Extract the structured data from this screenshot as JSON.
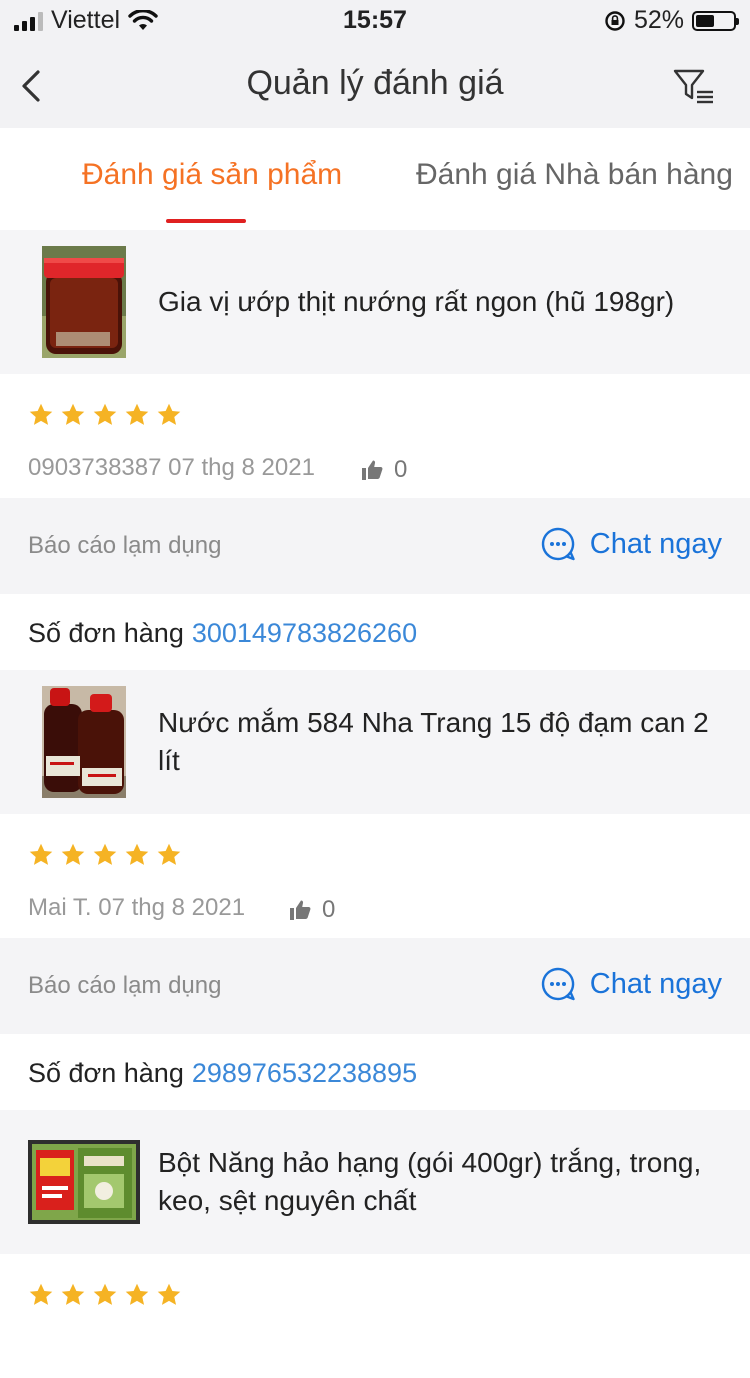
{
  "status_bar": {
    "carrier": "Viettel",
    "time": "15:57",
    "battery": "52%"
  },
  "nav": {
    "title": "Quản lý đánh giá",
    "back_icon": "back-chevron-icon",
    "filter_icon": "filter-icon"
  },
  "tabs": [
    {
      "label": "Đánh giá sản phẩm",
      "active": true
    },
    {
      "label": "Đánh giá Nhà bán hàng",
      "active": false
    }
  ],
  "reviews": [
    {
      "product_name": "Gia vị ướp thịt nướng rất ngon (hũ 198gr)",
      "stars": 5,
      "meta": "0903738387 07 thg 8 2021",
      "likes": "0",
      "report": "Báo cáo lạm dụng",
      "chat": "Chat ngay",
      "order_label": "Số đơn hàng",
      "order_number": "300149783826260"
    },
    {
      "product_name": "Nước mắm 584 Nha Trang 15 độ đạm can 2 lít",
      "stars": 5,
      "meta": "Mai T. 07 thg 8 2021",
      "likes": "0",
      "report": "Báo cáo lạm dụng",
      "chat": "Chat ngay",
      "order_label": "Số đơn hàng",
      "order_number": "298976532238895"
    },
    {
      "product_name": "Bột Năng hảo hạng (gói 400gr) trắng, trong, keo, sệt nguyên chất",
      "stars": 5
    }
  ],
  "colors": {
    "accent": "#f57224",
    "indicator": "#e02020",
    "link": "#3b88d8",
    "star": "#f5b324"
  }
}
